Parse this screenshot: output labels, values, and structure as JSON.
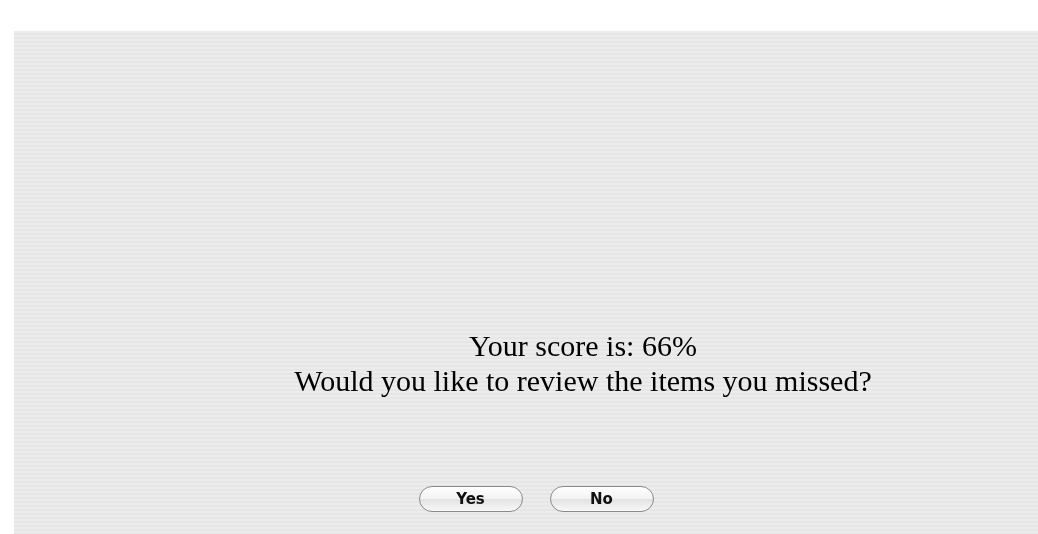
{
  "message": {
    "score_line": "Your score is: 66%",
    "question": "Would you like to review the items you missed?"
  },
  "buttons": [
    {
      "label": "Yes"
    },
    {
      "label": "No"
    }
  ]
}
